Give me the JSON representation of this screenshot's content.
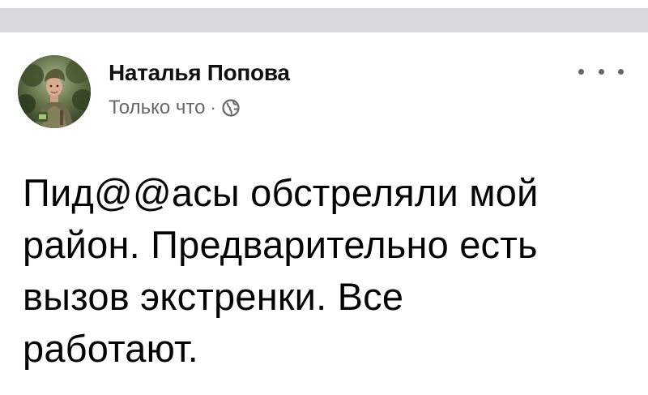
{
  "post": {
    "author_name": "Наталья Попова",
    "timestamp": "Только что",
    "separator": "·",
    "privacy_icon": "globe-icon",
    "more_icon": "more-options-icon",
    "text_lines": [
      "Пид@@асы обстреляли мой",
      "район. Предварительно есть",
      "вызов экстренки. Все",
      "работают."
    ]
  },
  "colors": {
    "top_bar": "#d9dadf",
    "name": "#111111",
    "meta": "#65676b",
    "text": "#050505"
  }
}
